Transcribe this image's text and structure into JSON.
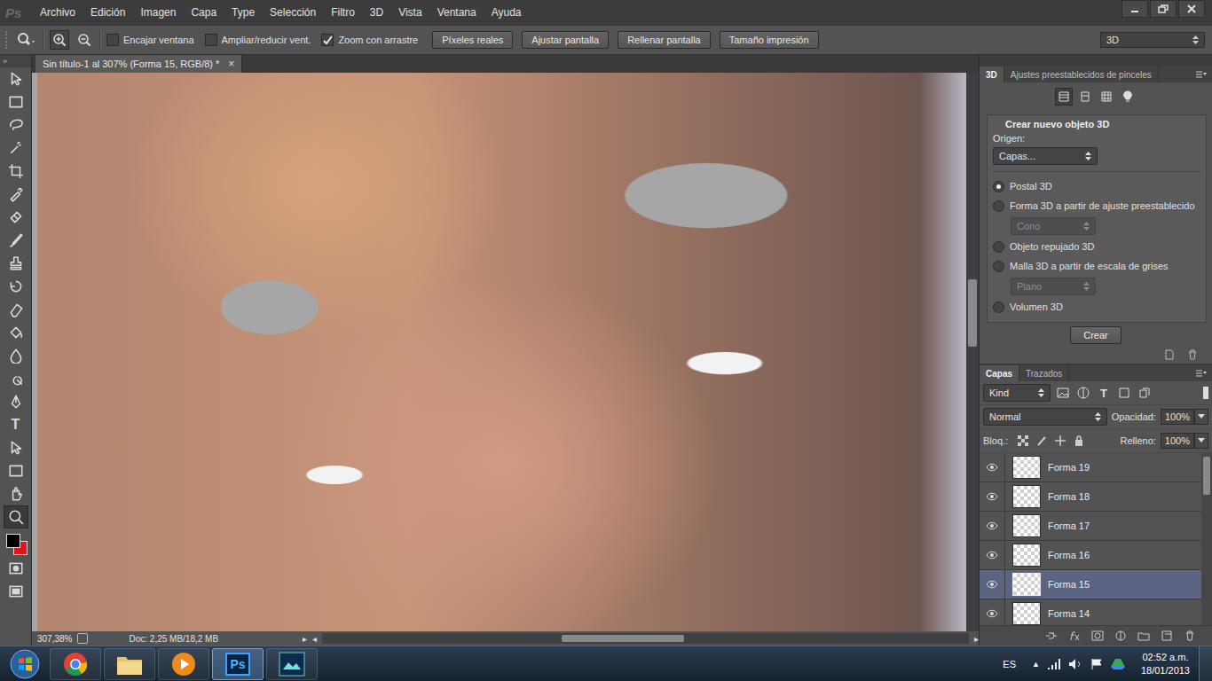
{
  "app_logo": "Ps",
  "menu": [
    "Archivo",
    "Edición",
    "Imagen",
    "Capa",
    "Type",
    "Selección",
    "Filtro",
    "3D",
    "Vista",
    "Ventana",
    "Ayuda"
  ],
  "options_bar": {
    "zoom_modes": [
      {
        "selected": true
      },
      {
        "selected": false
      }
    ],
    "checkboxes": [
      {
        "label": "Encajar ventana",
        "checked": false
      },
      {
        "label": "Ampliar/reducir vent.",
        "checked": false
      },
      {
        "label": "Zoom con arrastre",
        "checked": true
      }
    ],
    "buttons": [
      "Píxeles reales",
      "Ajustar pantalla",
      "Rellenar pantalla",
      "Tamaño impresión"
    ],
    "workspace": "3D"
  },
  "tools": [
    {
      "selected": false
    },
    {
      "selected": false
    },
    {
      "selected": false
    },
    {
      "selected": false
    },
    {
      "selected": false
    },
    {
      "selected": false
    },
    {
      "selected": false
    },
    {
      "selected": false
    },
    {
      "selected": false
    },
    {
      "selected": false
    },
    {
      "selected": false
    },
    {
      "selected": false
    },
    {
      "selected": false
    },
    {
      "selected": false
    },
    {
      "selected": false
    },
    {
      "glyph": "T",
      "selected": false
    },
    {
      "selected": false
    },
    {
      "selected": false
    },
    {
      "selected": false
    },
    {
      "selected": true
    }
  ],
  "swatches": {
    "foreground": "#000000",
    "background": "#e3141c"
  },
  "document": {
    "tab": "Sin título-1 al 307% (Forma 15, RGB/8) *",
    "close": "×",
    "vscroll": {
      "start": 0.37,
      "size": 0.12
    },
    "hscroll": {
      "start": 0.37,
      "size": 0.19
    }
  },
  "status_bar": {
    "zoom": "307,38%",
    "doc": "Doc: 2,25 MB/18,2 MB",
    "arrow": "▸",
    "scroll_left": "◂",
    "scroll_right": "▸"
  },
  "panel_3d": {
    "tabs": [
      {
        "label": "3D",
        "selected": true
      },
      {
        "label": "Ajustes preestablecidos de pinceles",
        "selected": false
      }
    ],
    "views": [
      {
        "selected": true
      },
      {
        "selected": false
      },
      {
        "selected": false
      },
      {
        "selected": false
      }
    ],
    "title": "Crear nuevo objeto 3D",
    "source_label": "Origen:",
    "source": "Capas...",
    "options": [
      {
        "kind": "radio",
        "label": "Postal 3D",
        "selected": true
      },
      {
        "kind": "radio",
        "label": "Forma 3D a partir de ajuste preestablecido",
        "selected": false
      },
      {
        "kind": "select",
        "value": "Cono",
        "disabled": true
      },
      {
        "kind": "radio",
        "label": "Objeto repujado 3D",
        "selected": false
      },
      {
        "kind": "radio",
        "label": "Malla 3D a partir de escala de grises",
        "selected": false
      },
      {
        "kind": "select",
        "value": "Plano",
        "disabled": true
      },
      {
        "kind": "radio",
        "label": "Volumen 3D",
        "selected": false
      }
    ],
    "button": "Crear"
  },
  "layers_panel": {
    "tabs": [
      {
        "label": "Capas",
        "selected": true
      },
      {
        "label": "Trazados",
        "selected": false
      }
    ],
    "filter": "Kind",
    "text_filter_glyph": "T",
    "blend": "Normal",
    "opacity_label": "Opacidad:",
    "opacity": "100%",
    "lock_label": "Bloq.:",
    "fill_label": "Relleno:",
    "fill": "100%",
    "layers": [
      {
        "name": "Forma 19",
        "visible": true,
        "selected": false
      },
      {
        "name": "Forma 18",
        "visible": true,
        "selected": false
      },
      {
        "name": "Forma 17",
        "visible": true,
        "selected": false
      },
      {
        "name": "Forma 16",
        "visible": true,
        "selected": false
      },
      {
        "name": "Forma 15",
        "visible": true,
        "selected": true
      },
      {
        "name": "Forma 14",
        "visible": true,
        "selected": false
      }
    ],
    "scroll": {
      "start": 0.02,
      "size": 0.22
    }
  },
  "taskbar": {
    "apps": [
      {
        "label": "",
        "selected": false
      },
      {
        "label": "",
        "selected": false
      },
      {
        "label": "",
        "selected": false
      },
      {
        "label": "Ps",
        "selected": true
      },
      {
        "label": "",
        "selected": false
      }
    ],
    "language": "ES",
    "tray_arrow": "▲",
    "time": "02:52 a.m.",
    "date": "18/01/2013"
  }
}
